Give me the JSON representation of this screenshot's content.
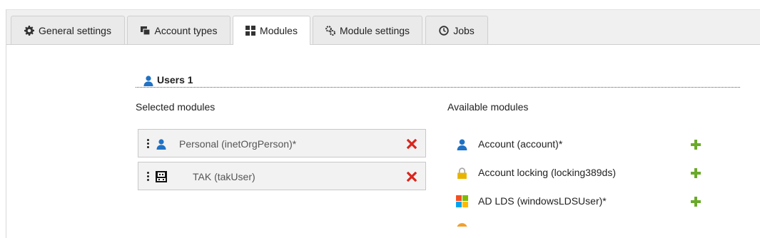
{
  "tabs": [
    {
      "label": "General settings",
      "icon": "gear-icon"
    },
    {
      "label": "Account types",
      "icon": "account-types-icon"
    },
    {
      "label": "Modules",
      "icon": "grid-icon",
      "active": true
    },
    {
      "label": "Module settings",
      "icon": "gears-icon"
    },
    {
      "label": "Jobs",
      "icon": "clock-icon"
    }
  ],
  "section": {
    "title": "Users 1",
    "icon": "user-icon"
  },
  "selected": {
    "label": "Selected modules",
    "items": [
      {
        "label": "Personal (inetOrgPerson)*",
        "icon": "user-icon"
      },
      {
        "label": "TAK (takUser)",
        "icon": "tak-icon"
      }
    ]
  },
  "available": {
    "label": "Available modules",
    "items": [
      {
        "label": "Account (account)*",
        "icon": "user-icon"
      },
      {
        "label": "Account locking (locking389ds)",
        "icon": "lock-icon"
      },
      {
        "label": "AD LDS (windowsLDSUser)*",
        "icon": "windows-icon"
      }
    ]
  },
  "colors": {
    "accent_blue": "#1f72c4",
    "remove_red": "#d9261c",
    "add_green": "#6aaa2a",
    "lock_yellow": "#e8b400"
  }
}
